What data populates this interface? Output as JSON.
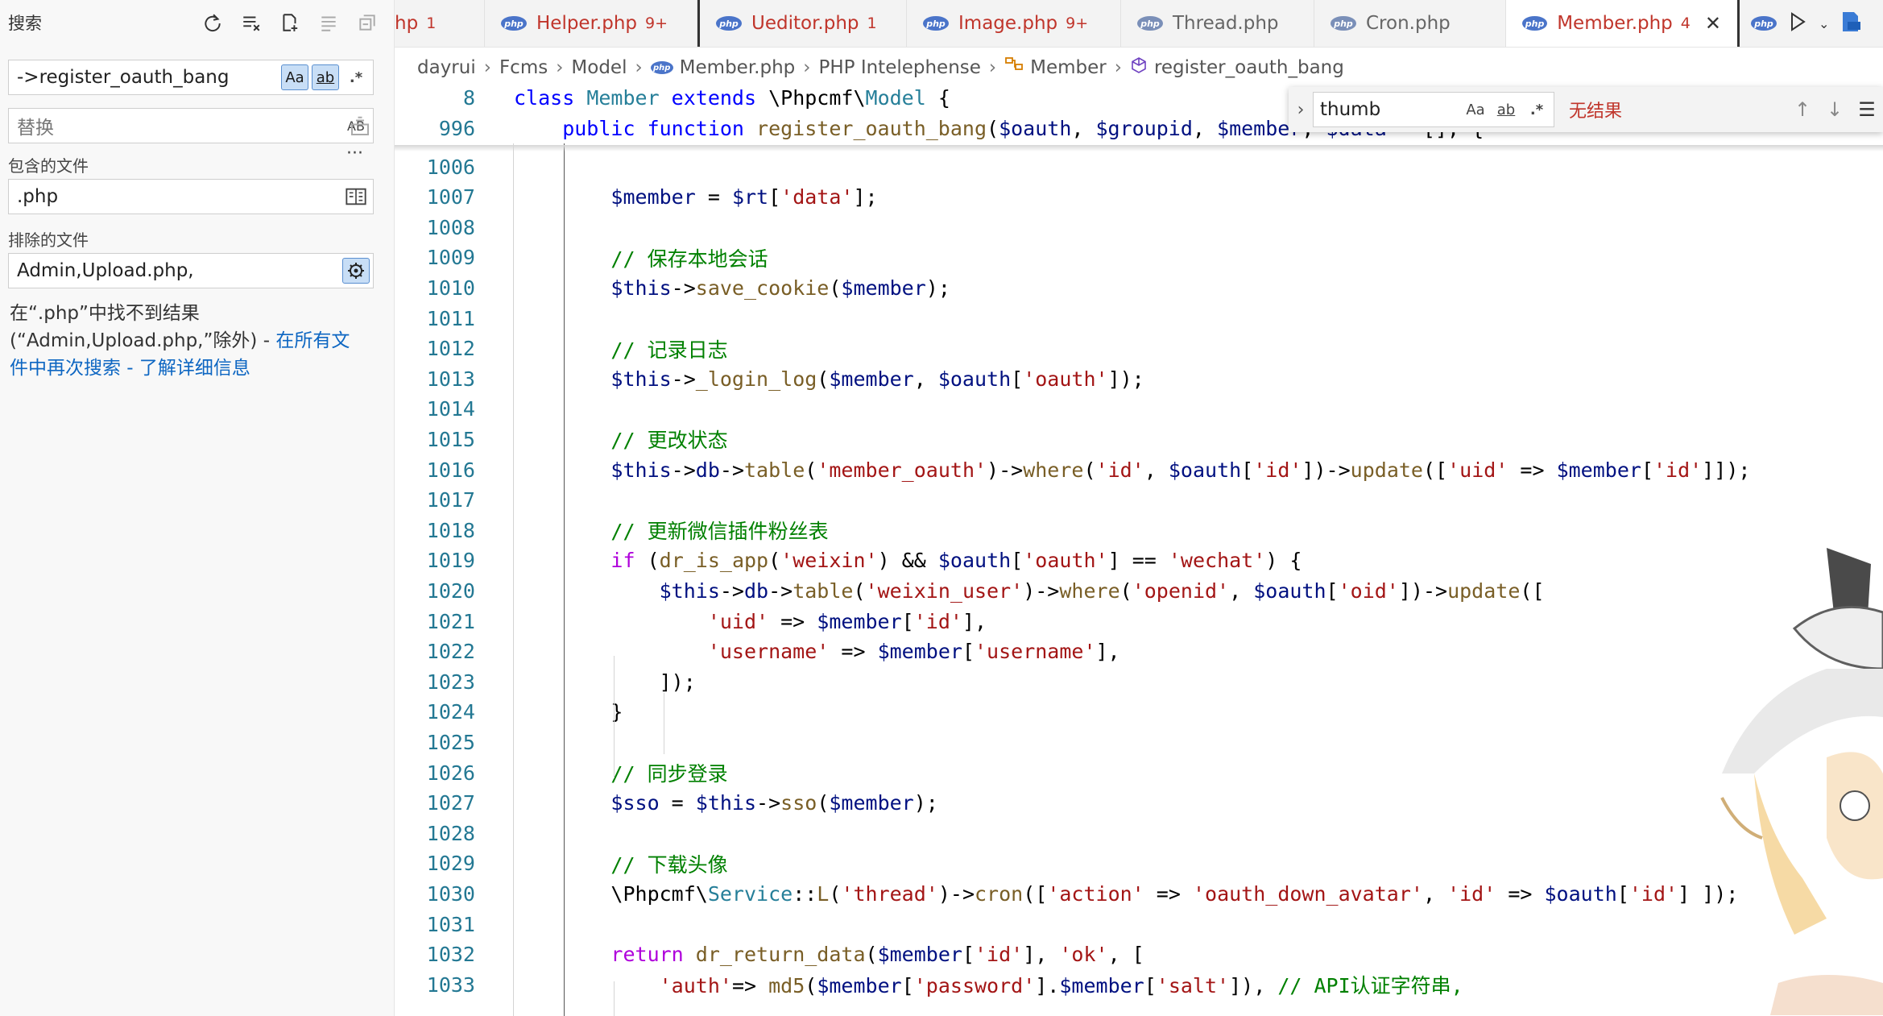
{
  "sidebar": {
    "title": "搜索",
    "search_value": "->register_oauth_bang",
    "match_case": "Aa",
    "whole_word": "ab",
    "regex": ".*",
    "replace_placeholder": "替换",
    "preserve_case": "AB",
    "more": "···",
    "include_label": "包含的文件",
    "include_value": ".php",
    "exclude_label": "排除的文件",
    "exclude_value": "Admin,Upload.php,",
    "message_prefix": "在“.php”中找不到结果(“Admin,Upload.php,”除外) - ",
    "message_link1": "在所有文件中再次搜索",
    "message_sep": " - ",
    "message_link2": "了解详细信息"
  },
  "tabs": [
    {
      "name": "hp",
      "count": "1",
      "state": "err"
    },
    {
      "name": "Helper.php",
      "count": "9+",
      "state": "err"
    },
    {
      "name": "Ueditor.php",
      "count": "1",
      "state": "err"
    },
    {
      "name": "Image.php",
      "count": "9+",
      "state": "err"
    },
    {
      "name": "Thread.php",
      "count": "",
      "state": "plain"
    },
    {
      "name": "Cron.php",
      "count": "",
      "state": "plain"
    },
    {
      "name": "Member.php",
      "count": "4",
      "state": "err"
    }
  ],
  "php_badge": "php",
  "breadcrumb": {
    "p1": "dayrui",
    "p2": "Fcms",
    "p3": "Model",
    "p4": "Member.php",
    "p5": "PHP Intelephense",
    "p6": "Member",
    "p7": "register_oauth_bang"
  },
  "find": {
    "value": "thumb",
    "match_case": "Aa",
    "whole_word": "ab",
    "regex": ".*",
    "result": "无结果"
  },
  "sticky": [
    {
      "ln": "8",
      "tokens": [
        [
          "kw",
          "class "
        ],
        [
          "cls",
          "Member "
        ],
        [
          "kw",
          "extends "
        ],
        [
          "pl",
          "\\Phpcmf\\"
        ],
        [
          "cls",
          "Model "
        ],
        [
          "pl",
          "{"
        ]
      ]
    },
    {
      "ln": "996",
      "tokens": [
        [
          "kw",
          "    public function "
        ],
        [
          "fn",
          "register_oauth_bang"
        ],
        [
          "pl",
          "("
        ],
        [
          "var",
          "$oauth"
        ],
        [
          "pl",
          ", "
        ],
        [
          "var",
          "$groupid"
        ],
        [
          "pl",
          ", "
        ],
        [
          "var",
          "$member"
        ],
        [
          "pl",
          ", "
        ],
        [
          "var",
          "$data"
        ],
        [
          "pl",
          " = [], {"
        ]
      ]
    }
  ],
  "lines": [
    {
      "ln": "1006",
      "tokens": []
    },
    {
      "ln": "1007",
      "tokens": [
        [
          "var",
          "        $member"
        ],
        [
          "pl",
          " = "
        ],
        [
          "var",
          "$rt"
        ],
        [
          "pl",
          "["
        ],
        [
          "str",
          "'data'"
        ],
        [
          "pl",
          "];"
        ]
      ]
    },
    {
      "ln": "1008",
      "tokens": []
    },
    {
      "ln": "1009",
      "tokens": [
        [
          "cm",
          "        // 保存本地会话"
        ]
      ]
    },
    {
      "ln": "1010",
      "tokens": [
        [
          "var",
          "        $this"
        ],
        [
          "pl",
          "->"
        ],
        [
          "fn",
          "save_cookie"
        ],
        [
          "pl",
          "("
        ],
        [
          "var",
          "$member"
        ],
        [
          "pl",
          ");"
        ]
      ]
    },
    {
      "ln": "1011",
      "tokens": []
    },
    {
      "ln": "1012",
      "tokens": [
        [
          "cm",
          "        // 记录日志"
        ]
      ]
    },
    {
      "ln": "1013",
      "tokens": [
        [
          "var",
          "        $this"
        ],
        [
          "pl",
          "->"
        ],
        [
          "fn",
          "_login_log"
        ],
        [
          "pl",
          "("
        ],
        [
          "var",
          "$member"
        ],
        [
          "pl",
          ", "
        ],
        [
          "var",
          "$oauth"
        ],
        [
          "pl",
          "["
        ],
        [
          "str",
          "'oauth'"
        ],
        [
          "pl",
          "]);"
        ]
      ]
    },
    {
      "ln": "1014",
      "tokens": []
    },
    {
      "ln": "1015",
      "tokens": [
        [
          "cm",
          "        // 更改状态"
        ]
      ]
    },
    {
      "ln": "1016",
      "tokens": [
        [
          "var",
          "        $this"
        ],
        [
          "pl",
          "->"
        ],
        [
          "var",
          "db"
        ],
        [
          "pl",
          "->"
        ],
        [
          "fn",
          "table"
        ],
        [
          "pl",
          "("
        ],
        [
          "str",
          "'member_oauth'"
        ],
        [
          "pl",
          ")->"
        ],
        [
          "fn",
          "where"
        ],
        [
          "pl",
          "("
        ],
        [
          "str",
          "'id'"
        ],
        [
          "pl",
          ", "
        ],
        [
          "var",
          "$oauth"
        ],
        [
          "pl",
          "["
        ],
        [
          "str",
          "'id'"
        ],
        [
          "pl",
          "])->"
        ],
        [
          "fn",
          "update"
        ],
        [
          "pl",
          "(["
        ],
        [
          "str",
          "'uid'"
        ],
        [
          "pl",
          " => "
        ],
        [
          "var",
          "$member"
        ],
        [
          "pl",
          "["
        ],
        [
          "str",
          "'id'"
        ],
        [
          "pl",
          "]]);"
        ]
      ]
    },
    {
      "ln": "1017",
      "tokens": []
    },
    {
      "ln": "1018",
      "tokens": [
        [
          "cm",
          "        // 更新微信插件粉丝表"
        ]
      ]
    },
    {
      "ln": "1019",
      "tokens": [
        [
          "kw2",
          "        if "
        ],
        [
          "pl",
          "("
        ],
        [
          "fn",
          "dr_is_app"
        ],
        [
          "pl",
          "("
        ],
        [
          "str",
          "'weixin'"
        ],
        [
          "pl",
          ") && "
        ],
        [
          "var",
          "$oauth"
        ],
        [
          "pl",
          "["
        ],
        [
          "str",
          "'oauth'"
        ],
        [
          "pl",
          "] == "
        ],
        [
          "str",
          "'wechat'"
        ],
        [
          "pl",
          ") {"
        ]
      ]
    },
    {
      "ln": "1020",
      "tokens": [
        [
          "var",
          "            $this"
        ],
        [
          "pl",
          "->"
        ],
        [
          "var",
          "db"
        ],
        [
          "pl",
          "->"
        ],
        [
          "fn",
          "table"
        ],
        [
          "pl",
          "("
        ],
        [
          "str",
          "'weixin_user'"
        ],
        [
          "pl",
          ")->"
        ],
        [
          "fn",
          "where"
        ],
        [
          "pl",
          "("
        ],
        [
          "str",
          "'openid'"
        ],
        [
          "pl",
          ", "
        ],
        [
          "var",
          "$oauth"
        ],
        [
          "pl",
          "["
        ],
        [
          "str",
          "'oid'"
        ],
        [
          "pl",
          "])->"
        ],
        [
          "fn",
          "update"
        ],
        [
          "pl",
          "(["
        ]
      ]
    },
    {
      "ln": "1021",
      "tokens": [
        [
          "str",
          "                'uid'"
        ],
        [
          "pl",
          " => "
        ],
        [
          "var",
          "$member"
        ],
        [
          "pl",
          "["
        ],
        [
          "str",
          "'id'"
        ],
        [
          "pl",
          "],"
        ]
      ]
    },
    {
      "ln": "1022",
      "tokens": [
        [
          "str",
          "                'username'"
        ],
        [
          "pl",
          " => "
        ],
        [
          "var",
          "$member"
        ],
        [
          "pl",
          "["
        ],
        [
          "str",
          "'username'"
        ],
        [
          "pl",
          "],"
        ]
      ]
    },
    {
      "ln": "1023",
      "tokens": [
        [
          "pl",
          "            ]);"
        ]
      ]
    },
    {
      "ln": "1024",
      "tokens": [
        [
          "pl",
          "        }"
        ]
      ]
    },
    {
      "ln": "1025",
      "tokens": []
    },
    {
      "ln": "1026",
      "tokens": [
        [
          "cm",
          "        // 同步登录"
        ]
      ]
    },
    {
      "ln": "1027",
      "tokens": [
        [
          "var",
          "        $sso"
        ],
        [
          "pl",
          " = "
        ],
        [
          "var",
          "$this"
        ],
        [
          "pl",
          "->"
        ],
        [
          "fn",
          "sso"
        ],
        [
          "pl",
          "("
        ],
        [
          "var",
          "$member"
        ],
        [
          "pl",
          ");"
        ]
      ]
    },
    {
      "ln": "1028",
      "tokens": []
    },
    {
      "ln": "1029",
      "tokens": [
        [
          "cm",
          "        // 下载头像"
        ]
      ]
    },
    {
      "ln": "1030",
      "tokens": [
        [
          "pl",
          "        \\Phpcmf\\"
        ],
        [
          "cls",
          "Service"
        ],
        [
          "pl",
          "::"
        ],
        [
          "fn",
          "L"
        ],
        [
          "pl",
          "("
        ],
        [
          "str",
          "'thread'"
        ],
        [
          "pl",
          ")->"
        ],
        [
          "fn",
          "cron"
        ],
        [
          "pl",
          "(["
        ],
        [
          "str",
          "'action'"
        ],
        [
          "pl",
          " => "
        ],
        [
          "str",
          "'oauth_down_avatar'"
        ],
        [
          "pl",
          ", "
        ],
        [
          "str",
          "'id'"
        ],
        [
          "pl",
          " => "
        ],
        [
          "var",
          "$oauth"
        ],
        [
          "pl",
          "["
        ],
        [
          "str",
          "'id'"
        ],
        [
          "pl",
          "] ]);"
        ]
      ]
    },
    {
      "ln": "1031",
      "tokens": []
    },
    {
      "ln": "1032",
      "tokens": [
        [
          "kw2",
          "        return "
        ],
        [
          "fn",
          "dr_return_data"
        ],
        [
          "pl",
          "("
        ],
        [
          "var",
          "$member"
        ],
        [
          "pl",
          "["
        ],
        [
          "str",
          "'id'"
        ],
        [
          "pl",
          "], "
        ],
        [
          "str",
          "'ok'"
        ],
        [
          "pl",
          ", ["
        ]
      ]
    },
    {
      "ln": "1033",
      "tokens": [
        [
          "str",
          "            'auth'"
        ],
        [
          "pl",
          "=> "
        ],
        [
          "fn",
          "md5"
        ],
        [
          "pl",
          "("
        ],
        [
          "var",
          "$member"
        ],
        [
          "pl",
          "["
        ],
        [
          "str",
          "'password'"
        ],
        [
          "pl",
          "]."
        ],
        [
          "var",
          "$member"
        ],
        [
          "pl",
          "["
        ],
        [
          "str",
          "'salt'"
        ],
        [
          "pl",
          "]), "
        ],
        [
          "cm",
          "// API认证字符串,"
        ]
      ]
    }
  ]
}
